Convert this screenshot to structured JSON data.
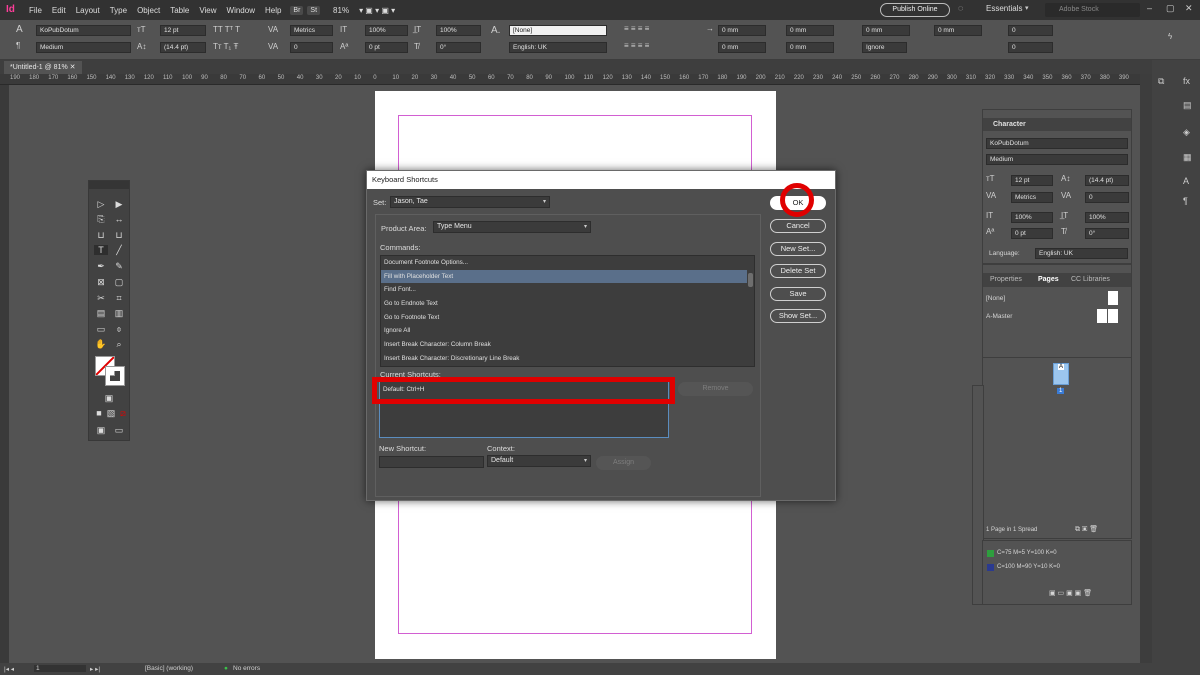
{
  "menubar": {
    "app_logo": "Id",
    "items": [
      "File",
      "Edit",
      "Layout",
      "Type",
      "Object",
      "Table",
      "View",
      "Window",
      "Help"
    ],
    "bridge_chip": "Br",
    "stock_chip": "St",
    "zoom": "81%",
    "publish_online": "Publish Online",
    "workspace": "Essentials",
    "stock_search_placeholder": "Adobe Stock"
  },
  "control_bar": {
    "font_family": "KoPubDotum",
    "font_style": "Medium",
    "font_size": "12 pt",
    "leading": "(14.4 pt)",
    "kerning": "Metrics",
    "tracking": "0",
    "vertical_scale": "100%",
    "horizontal_scale": "100%",
    "baseline_shift": "0 pt",
    "skew": "0°",
    "char_style": "[None]",
    "language": "English: UK",
    "indent_1": "0 mm",
    "indent_2": "0 mm",
    "indent_3": "0 mm",
    "indent_4": "0 mm",
    "space_1": "0 mm",
    "space_2": "0 mm",
    "space_3": "0",
    "space_4": "0",
    "hyphenation": "Ignore"
  },
  "document": {
    "tab_title": "*Untitled-1 @ 81%",
    "ruler_ticks": [
      "190",
      "180",
      "170",
      "160",
      "150",
      "140",
      "130",
      "120",
      "110",
      "100",
      "90",
      "80",
      "70",
      "60",
      "50",
      "40",
      "30",
      "20",
      "10",
      "0",
      "10",
      "20",
      "30",
      "40",
      "50",
      "60",
      "70",
      "80",
      "90",
      "100",
      "110",
      "120",
      "130",
      "140",
      "150",
      "160",
      "170",
      "180",
      "190",
      "200",
      "210",
      "220",
      "230",
      "240",
      "250",
      "260",
      "270",
      "280",
      "290",
      "300",
      "310",
      "320",
      "330",
      "340",
      "350",
      "360",
      "370",
      "380",
      "390"
    ]
  },
  "dialog": {
    "title": "Keyboard Shortcuts",
    "set_label": "Set:",
    "set_value": "Jason, Tae",
    "product_area_label": "Product Area:",
    "product_area_value": "Type Menu",
    "commands_label": "Commands:",
    "commands": [
      "Document Footnote Options...",
      "Fill with Placeholder Text",
      "Find Font...",
      "Go to Endnote Text",
      "Go to Footnote Text",
      "Ignore All",
      "Insert Break Character: Column Break",
      "Insert Break Character: Discretionary Line Break"
    ],
    "selected_command_index": 1,
    "current_shortcuts_label": "Current Shortcuts:",
    "current_shortcut": "Default: Ctrl+H",
    "remove_label": "Remove",
    "new_shortcut_label": "New Shortcut:",
    "new_shortcut_value": "",
    "context_label": "Context:",
    "context_value": "Default",
    "assign_label": "Assign",
    "buttons": {
      "ok": "OK",
      "cancel": "Cancel",
      "new_set": "New Set...",
      "delete_set": "Delete Set",
      "save": "Save",
      "show_set": "Show Set..."
    }
  },
  "character_panel": {
    "title": "Character",
    "font_family": "KoPubDotum",
    "font_style": "Medium",
    "size": "12 pt",
    "leading": "(14.4 pt)",
    "kerning": "Metrics",
    "tracking": "0",
    "vertical_scale": "100%",
    "horizontal_scale": "100%",
    "baseline": "0 pt",
    "skew": "0°",
    "language_label": "Language:",
    "language": "English: UK"
  },
  "pages_panel": {
    "tabs": [
      "Properties",
      "Pages",
      "CC Libraries"
    ],
    "none_master": "[None]",
    "a_master": "A-Master",
    "page_label": "A",
    "page_number": "1",
    "summary": "1 Page in 1 Spread"
  },
  "swatches": [
    {
      "label": "C=75 M=5 Y=100 K=0",
      "color": "#2e9e3e"
    },
    {
      "label": "C=100 M=90 Y=10 K=0",
      "color": "#2b3a8f"
    }
  ],
  "statusbar": {
    "page": "1",
    "style": "[Basic] (working)",
    "errors": "No errors"
  },
  "colors": {
    "annotation_red": "#e00000",
    "selection_blue": "#5a6f8a",
    "margin_magenta": "#d25fd2"
  }
}
